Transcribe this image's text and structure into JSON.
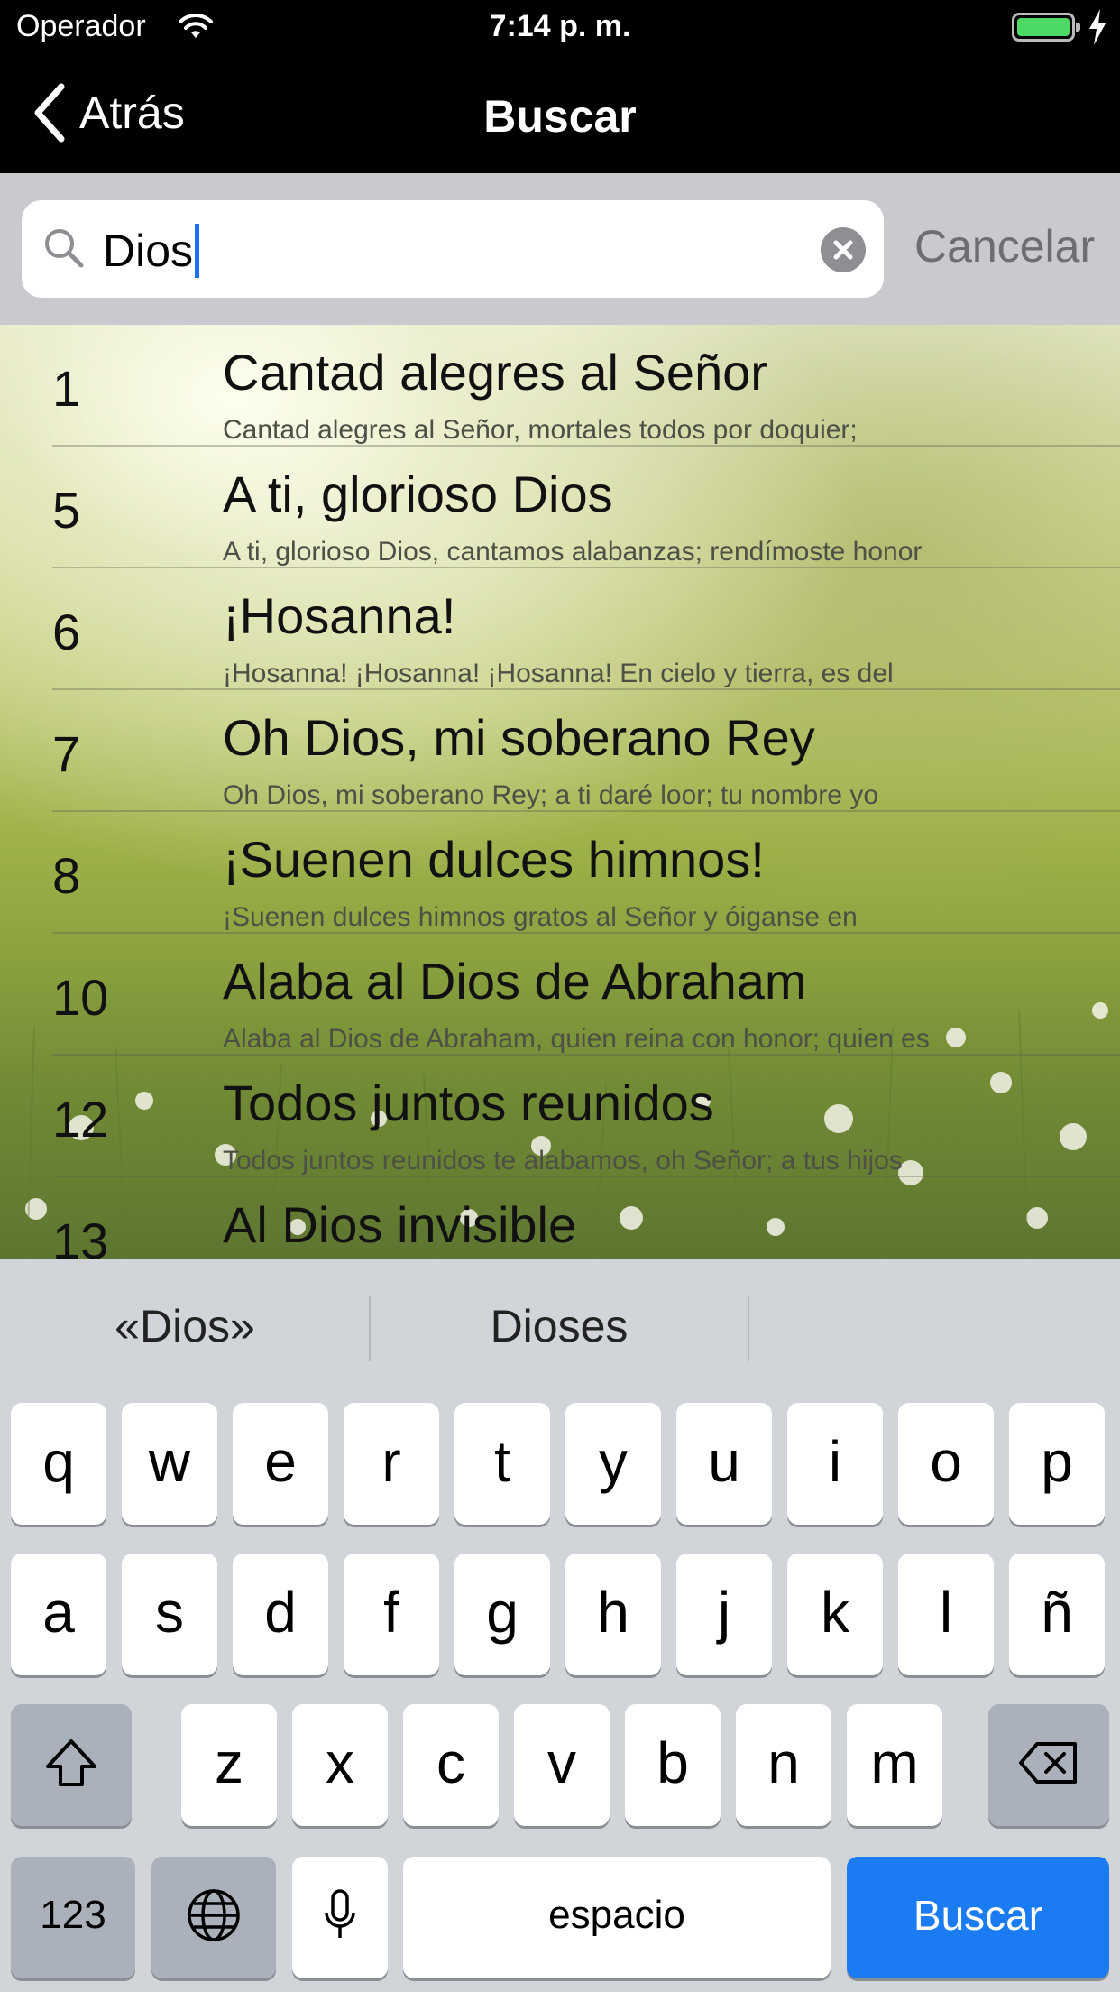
{
  "status_bar": {
    "carrier": "Operador",
    "time": "7:14 p. m.",
    "battery_color": "#4cd964"
  },
  "nav": {
    "back_label": "Atrás",
    "title": "Buscar"
  },
  "search": {
    "query": "Dios",
    "cancel_label": "Cancelar",
    "caret_color": "#1f6ff0"
  },
  "results": [
    {
      "number": "1",
      "title": "Cantad alegres al Señor",
      "snippet": "Cantad alegres al Señor, mortales todos por doquier;"
    },
    {
      "number": "5",
      "title": "A ti, glorioso Dios",
      "snippet": "A ti, glorioso Dios, cantamos alabanzas; rendímoste honor"
    },
    {
      "number": "6",
      "title": "¡Hosanna!",
      "snippet": "¡Hosanna! ¡Hosanna! ¡Hosanna! En cielo y tierra, es del"
    },
    {
      "number": "7",
      "title": "Oh Dios, mi soberano Rey",
      "snippet": "Oh Dios, mi soberano Rey; a ti daré loor; tu nombre yo"
    },
    {
      "number": "8",
      "title": "¡Suenen dulces himnos!",
      "snippet": "¡Suenen dulces himnos gratos al Señor y óiganse en"
    },
    {
      "number": "10",
      "title": "Alaba al Dios de Abraham",
      "snippet": "Alaba al Dios de Abraham, quien reina con honor; quien es"
    },
    {
      "number": "12",
      "title": "Todos juntos reunidos",
      "snippet": "Todos juntos reunidos te alabamos, oh Señor; a tus hijos"
    },
    {
      "number": "13",
      "title": "Al Dios invisible",
      "snippet": ""
    }
  ],
  "keyboard": {
    "suggestions": [
      "«Dios»",
      "Dioses"
    ],
    "row1": [
      "q",
      "w",
      "e",
      "r",
      "t",
      "y",
      "u",
      "i",
      "o",
      "p"
    ],
    "row2": [
      "a",
      "s",
      "d",
      "f",
      "g",
      "h",
      "j",
      "k",
      "l",
      "ñ"
    ],
    "row3": [
      "z",
      "x",
      "c",
      "v",
      "b",
      "n",
      "m"
    ],
    "numbers_label": "123",
    "space_label": "espacio",
    "return_label": "Buscar",
    "return_color": "#1a7bf2"
  }
}
